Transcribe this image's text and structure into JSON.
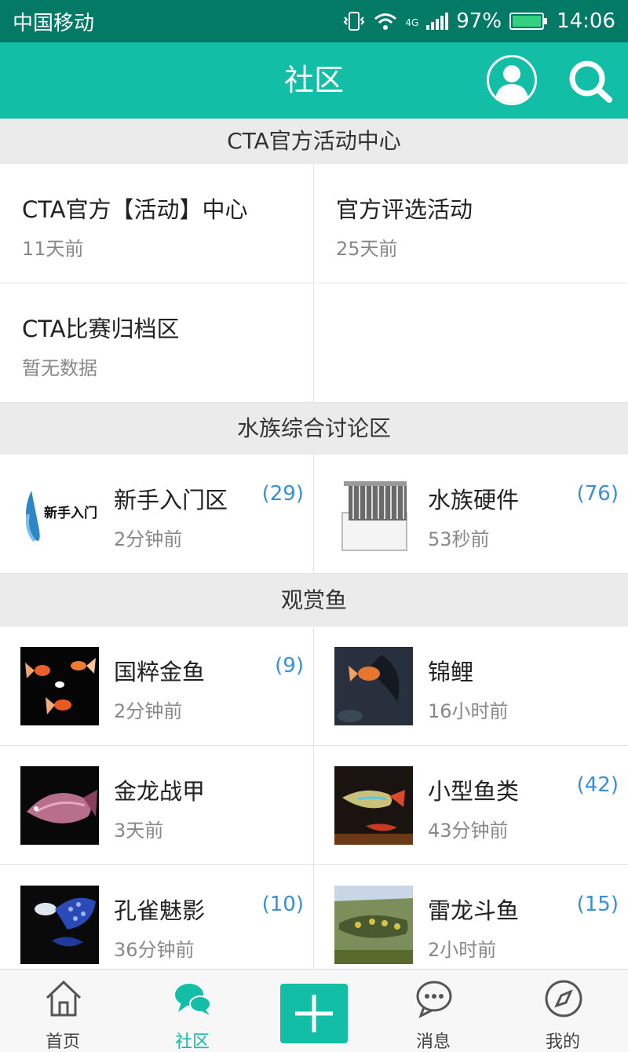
{
  "status_bar": {
    "carrier": "中国移动",
    "network": "4G",
    "battery": "97%",
    "time": "14:06"
  },
  "header": {
    "title": "社区"
  },
  "sections": [
    {
      "title": "CTA官方活动中心",
      "items": [
        {
          "name": "CTA官方【活动】中心",
          "time": "11天前"
        },
        {
          "name": "官方评选活动",
          "time": "25天前"
        },
        {
          "name": "CTA比赛归档区",
          "time": "暂无数据"
        }
      ]
    },
    {
      "title": "水族综合讨论区",
      "items": [
        {
          "name": "新手入门区",
          "time": "2分钟前",
          "count": "(29)",
          "logo_text": "新手入门"
        },
        {
          "name": "水族硬件",
          "time": "53秒前",
          "count": "(76)"
        }
      ]
    },
    {
      "title": "观赏鱼",
      "items": [
        {
          "name": "国粹金鱼",
          "time": "2分钟前",
          "count": "(9)"
        },
        {
          "name": "锦鲤",
          "time": "16小时前"
        },
        {
          "name": "金龙战甲",
          "time": "3天前"
        },
        {
          "name": "小型鱼类",
          "time": "43分钟前",
          "count": "(42)"
        },
        {
          "name": "孔雀魅影",
          "time": "36分钟前",
          "count": "(10)"
        },
        {
          "name": "雷龙斗鱼",
          "time": "2小时前",
          "count": "(15)"
        }
      ]
    }
  ],
  "bottom_nav": [
    {
      "label": "首页",
      "icon": "home-icon"
    },
    {
      "label": "社区",
      "icon": "community-icon",
      "active": true
    },
    {
      "label": "",
      "icon": "add-icon"
    },
    {
      "label": "消息",
      "icon": "message-icon"
    },
    {
      "label": "我的",
      "icon": "compass-icon"
    }
  ],
  "colors": {
    "accent": "#12bfa6",
    "status_bar": "#037a66",
    "count": "#3a8fd8",
    "section_bg": "#ebebeb"
  }
}
